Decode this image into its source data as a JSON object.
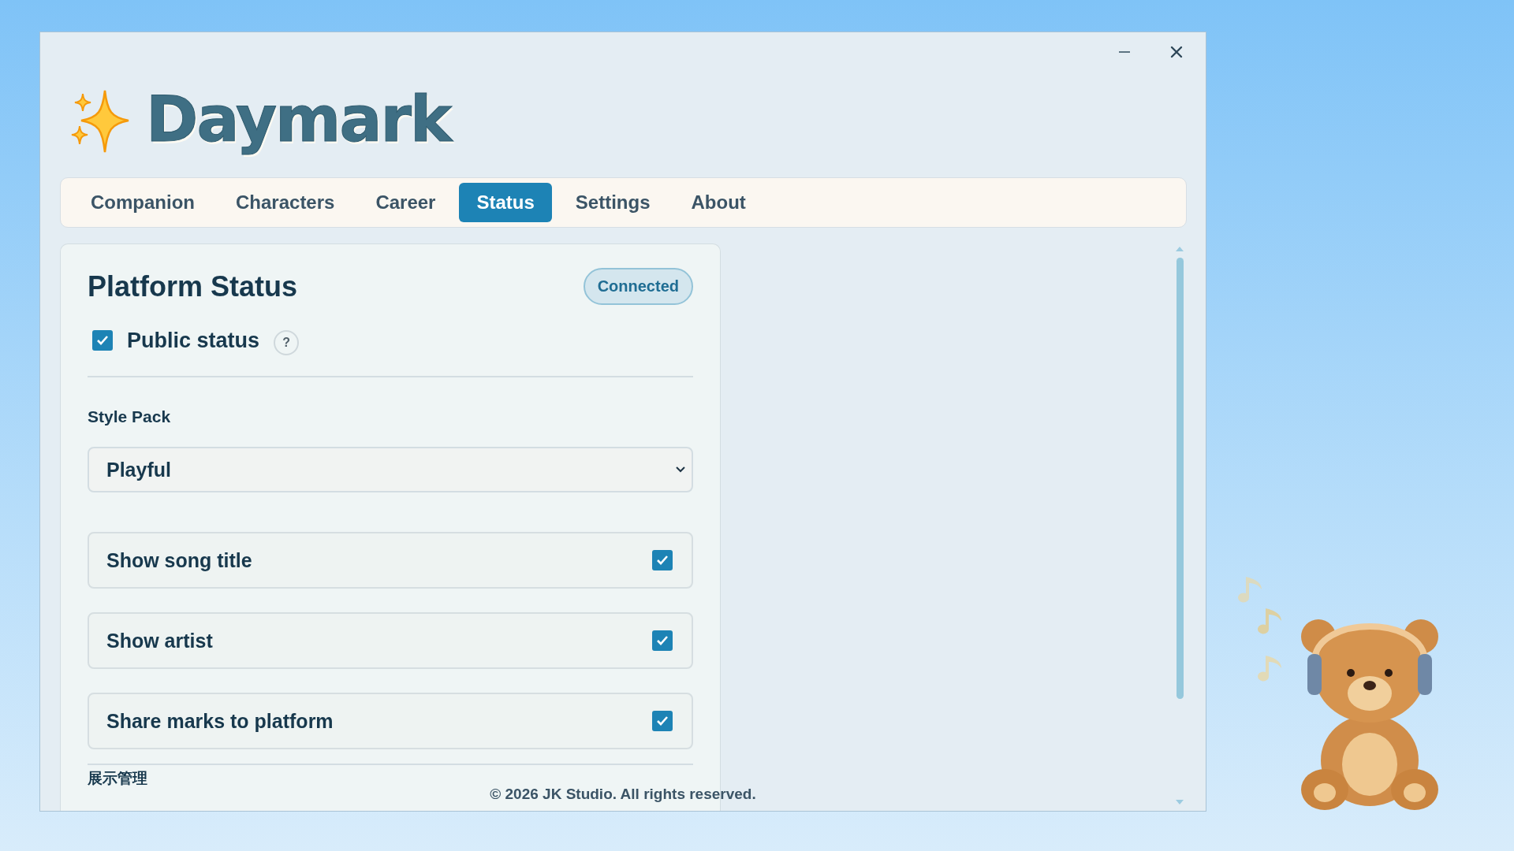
{
  "app": {
    "title": "Daymark"
  },
  "tabs": [
    {
      "label": "Companion",
      "selected": false
    },
    {
      "label": "Characters",
      "selected": false
    },
    {
      "label": "Career",
      "selected": false
    },
    {
      "label": "Status",
      "selected": true
    },
    {
      "label": "Settings",
      "selected": false
    },
    {
      "label": "About",
      "selected": false
    }
  ],
  "panel": {
    "title": "Platform Status",
    "badge": "Connected",
    "public_status": {
      "label": "Public status",
      "checked": true,
      "help": "?"
    },
    "style_pack": {
      "label": "Style Pack",
      "value": "Playful"
    },
    "toggles": [
      {
        "label": "Show song title",
        "checked": true
      },
      {
        "label": "Show artist",
        "checked": true
      },
      {
        "label": "Share marks to platform",
        "checked": true
      }
    ],
    "next_section": "展示管理"
  },
  "footer": "© 2026 JK Studio. All rights reserved."
}
